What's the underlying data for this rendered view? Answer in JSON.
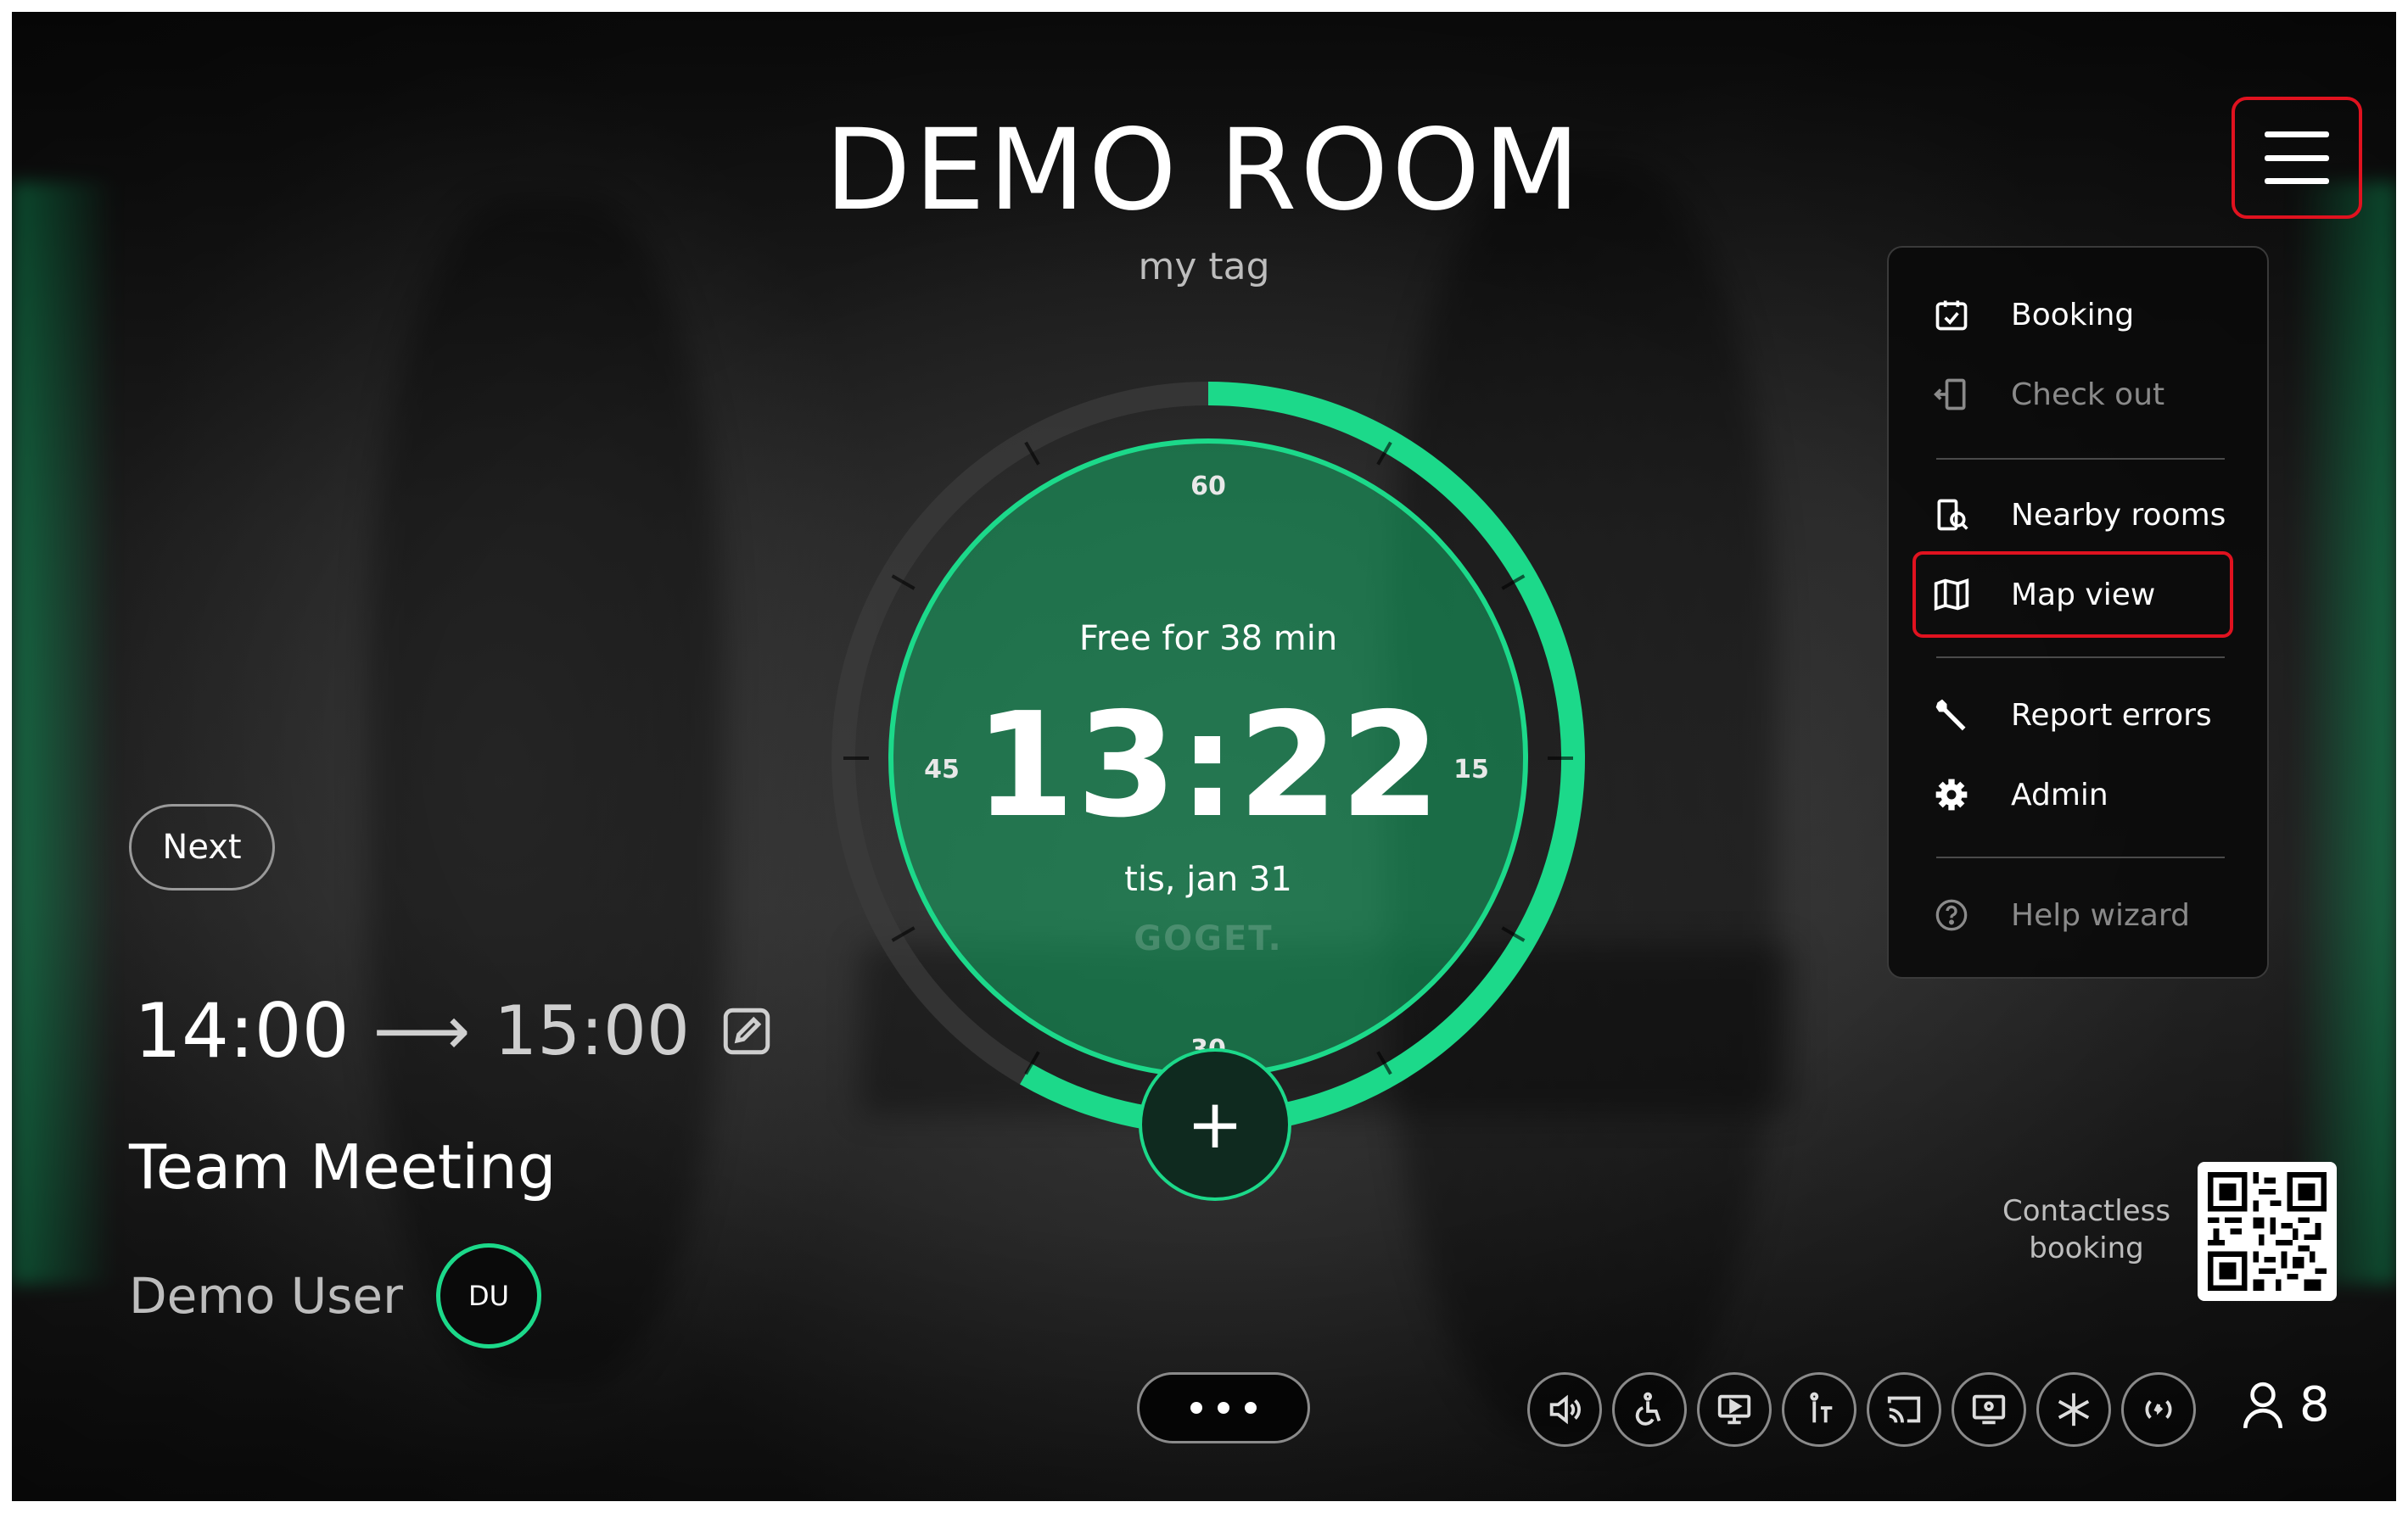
{
  "room": {
    "title": "DEMO ROOM",
    "tag": "my tag"
  },
  "clock": {
    "status": "Free for 38 min",
    "time": "13:22",
    "date": "tis, jan 31",
    "brand": "GOGET.",
    "dial_labels": {
      "top": "60",
      "right": "15",
      "bottom": "30",
      "left": "45"
    },
    "accent_color": "#1cd98a"
  },
  "menu": {
    "items": [
      {
        "label": "Booking",
        "icon": "calendar-check-icon",
        "enabled": true
      },
      {
        "label": "Check out",
        "icon": "door-exit-icon",
        "enabled": false
      },
      {
        "label": "Nearby rooms",
        "icon": "nearby-rooms-icon",
        "enabled": true
      },
      {
        "label": "Map view",
        "icon": "map-icon",
        "enabled": true,
        "highlighted": true
      },
      {
        "label": "Report errors",
        "icon": "wrench-icon",
        "enabled": true
      },
      {
        "label": "Admin",
        "icon": "gear-icon",
        "enabled": true
      },
      {
        "label": "Help wizard",
        "icon": "help-icon",
        "enabled": false
      }
    ],
    "highlight_color": "#e0121f"
  },
  "next_meeting": {
    "button_label": "Next",
    "start": "14:00",
    "arrow": "⟶",
    "end": "15:00",
    "title": "Team Meeting",
    "organizer": "Demo User",
    "organizer_initials": "DU"
  },
  "amenities": [
    "speaker-icon",
    "accessible-icon",
    "presentation-icon",
    "standing-desk-icon",
    "cast-icon",
    "video-conference-icon",
    "air-conditioning-icon",
    "wireless-icon"
  ],
  "capacity": {
    "icon": "person-icon",
    "value": "8"
  },
  "contactless": {
    "line1": "Contactless",
    "line2": "booking"
  }
}
